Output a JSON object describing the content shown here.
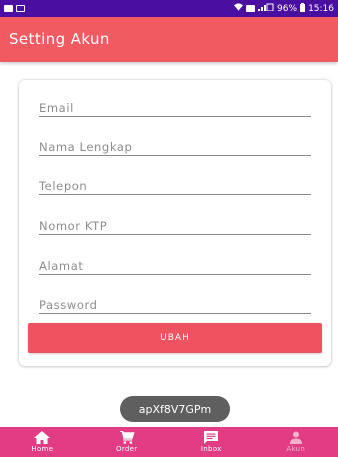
{
  "status_bar": {
    "battery": "96%",
    "time": "15:16"
  },
  "app_bar": {
    "title": "Setting Akun"
  },
  "form": {
    "fields": [
      {
        "placeholder": "Email"
      },
      {
        "placeholder": "Nama Lengkap"
      },
      {
        "placeholder": "Telepon"
      },
      {
        "placeholder": "Nomor KTP"
      },
      {
        "placeholder": "Alamat"
      },
      {
        "placeholder": "Password"
      }
    ],
    "submit_label": "UBAH"
  },
  "toast": {
    "text": "apXf8V7GPm"
  },
  "bottom_nav": {
    "items": [
      {
        "label": "Home",
        "icon": "home-icon",
        "active": false
      },
      {
        "label": "Order",
        "icon": "cart-icon",
        "active": false
      },
      {
        "label": "Inbox",
        "icon": "chat-icon",
        "active": false
      },
      {
        "label": "Akun",
        "icon": "person-icon",
        "active": true
      }
    ]
  }
}
